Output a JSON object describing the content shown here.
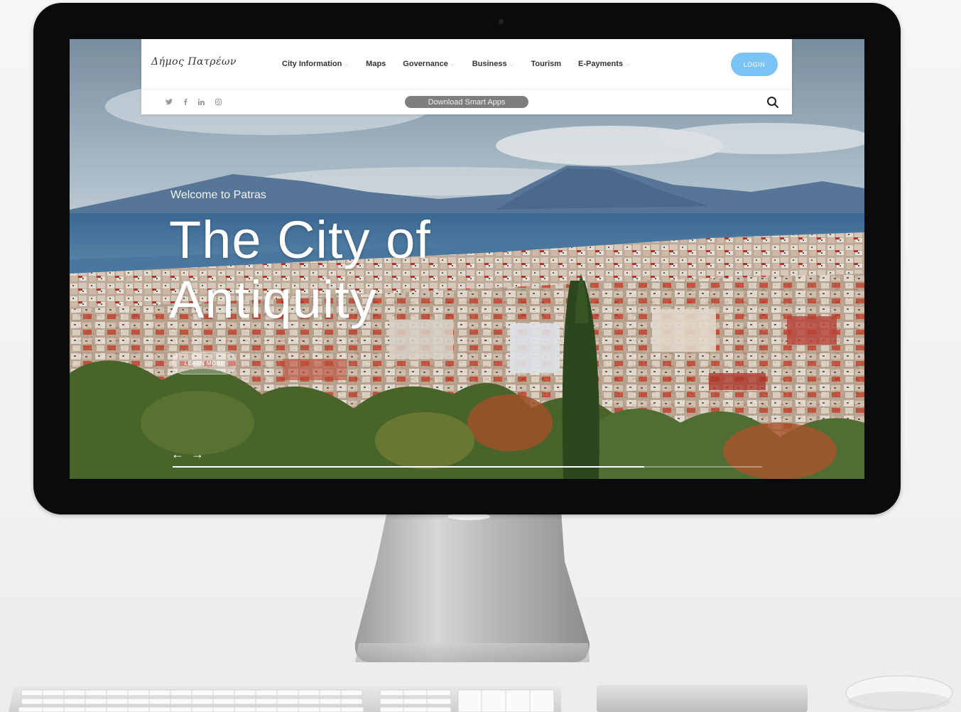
{
  "brand": {
    "logo_text": "Δήμος Πατρέων"
  },
  "nav": {
    "items": [
      {
        "label": "City Information",
        "dropdown": true
      },
      {
        "label": "Maps",
        "dropdown": false
      },
      {
        "label": "Governance",
        "dropdown": true
      },
      {
        "label": "Business",
        "dropdown": true
      },
      {
        "label": "Tourism",
        "dropdown": false
      },
      {
        "label": "E-Payments",
        "dropdown": true
      }
    ],
    "login_label": "LOGIN"
  },
  "subbar": {
    "socials": [
      "twitter-icon",
      "facebook-icon",
      "linkedin-icon",
      "instagram-icon"
    ],
    "download_label": "Download Smart Apps"
  },
  "hero": {
    "welcome": "Welcome to Patras",
    "title": "The City of Antiquity",
    "cta": "LEARN MORE",
    "slide_progress": 0.8
  },
  "colors": {
    "login_button": "#7cc3f5",
    "apps_button": "#7e7e7e"
  }
}
